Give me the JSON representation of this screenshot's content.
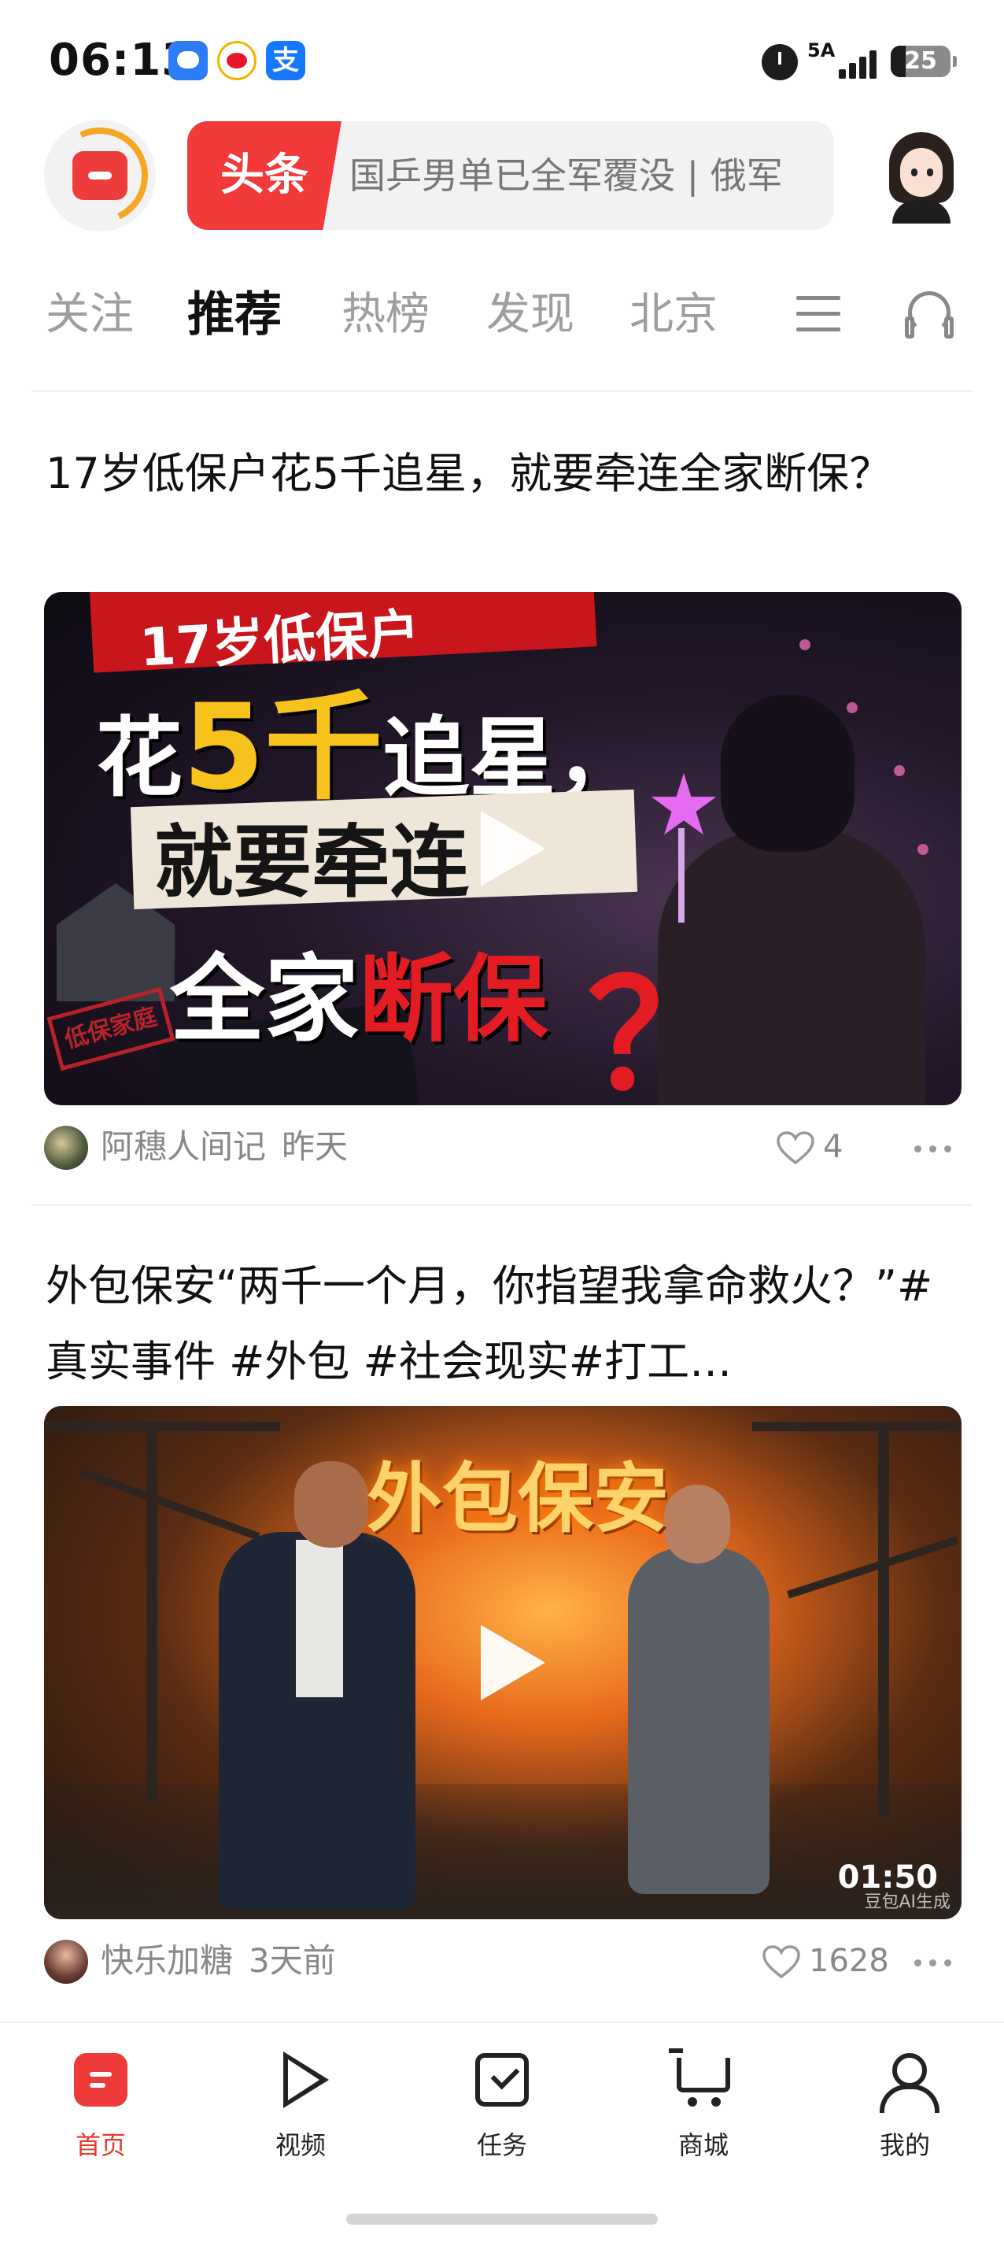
{
  "status_bar": {
    "time": "06:13",
    "apps": [
      "chat-app-icon",
      "weibo-icon",
      "alipay-icon"
    ],
    "alipay_glyph": "支",
    "network": "5A",
    "battery": "25",
    "battery_level": 0.25
  },
  "header": {
    "logo_icon": "toutiao-logo-icon",
    "search_tag": "头条",
    "search_hint": "国乒男单已全军覆没 | 俄军",
    "avatar_icon": "user-avatar"
  },
  "tabs": {
    "items": [
      "关注",
      "推荐",
      "热榜",
      "发现",
      "北京"
    ],
    "active": "推荐",
    "menu_icon": "menu-icon",
    "audio_icon": "headset-icon"
  },
  "feed": [
    {
      "title": "17岁低保户花5千追星，就要牵连全家断保？",
      "thumbnail_text": {
        "banner": "17岁低保户",
        "line1_a": "花",
        "line1_b": "5千",
        "line1_c": "追星，",
        "line2": "就要牵连",
        "line3_a": "全家",
        "line3_b": "断保",
        "qmark": "？",
        "stamp": "低保家庭"
      },
      "author": "阿穗人间记",
      "time": "昨天",
      "likes": "4"
    },
    {
      "title": "外包保安“两千一个月，你指望我拿命救火？”#真实事件 #外包 #社会现实#打工…",
      "thumbnail_text": {
        "overlay_title": "外包保安",
        "duration": "01:50",
        "watermark": "豆包AI生成"
      },
      "author": "快乐加糖",
      "time": "3天前",
      "likes": "1628"
    }
  ],
  "bottom_nav": {
    "items": [
      {
        "label": "首页",
        "icon": "home-icon",
        "active": true
      },
      {
        "label": "视频",
        "icon": "video-icon",
        "active": false
      },
      {
        "label": "任务",
        "icon": "task-icon",
        "active": false
      },
      {
        "label": "商城",
        "icon": "cart-icon",
        "active": false
      },
      {
        "label": "我的",
        "icon": "user-icon",
        "active": false
      }
    ]
  },
  "colors": {
    "brand_red": "#f23a3a",
    "accent_orange": "#f5a623",
    "active_nav": "#e83a2e",
    "muted_text": "#888888"
  }
}
